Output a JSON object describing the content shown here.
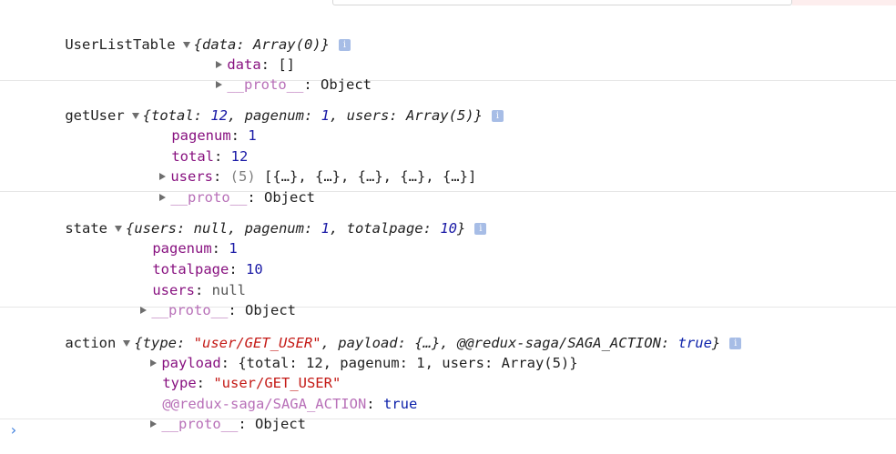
{
  "info_glyph": "i",
  "entries": [
    {
      "label": "UserListTable",
      "summary": {
        "pre": "{data: ",
        "val": "Array(0)",
        "post": "}"
      },
      "rows": [
        {
          "key": "data",
          "sep": ": ",
          "value": "[]"
        },
        {
          "key": "__proto__",
          "sep": ": ",
          "value": "Object"
        }
      ]
    },
    {
      "label": "getUser",
      "summary": {
        "p1": "{total: ",
        "v1": "12",
        "p2": ", pagenum: ",
        "v2": "1",
        "p3": ", users: Array(5)}"
      },
      "rows": [
        {
          "key": "pagenum",
          "sep": ": ",
          "value": "1"
        },
        {
          "key": "total",
          "sep": ": ",
          "value": "12"
        },
        {
          "key": "users",
          "sep": ": ",
          "count": "(5)",
          "value": " [{…}, {…}, {…}, {…}, {…}]"
        },
        {
          "key": "__proto__",
          "sep": ": ",
          "value": "Object"
        }
      ]
    },
    {
      "label": "state",
      "summary": {
        "p1": "{users: null, pagenum: ",
        "v1": "1",
        "p2": ", totalpage: ",
        "v2": "10",
        "p3": "}"
      },
      "rows": [
        {
          "key": "pagenum",
          "sep": ": ",
          "value": "1"
        },
        {
          "key": "totalpage",
          "sep": ": ",
          "value": "10"
        },
        {
          "key": "users",
          "sep": ": ",
          "value": "null"
        },
        {
          "key": "__proto__",
          "sep": ": ",
          "value": "Object"
        }
      ]
    },
    {
      "label": "action",
      "summary": {
        "p1": "{type: ",
        "v1": "\"user/GET_USER\"",
        "p2": ", payload: {…}, @@redux-saga/SAGA_ACTION: ",
        "v2": "true",
        "p3": "}"
      },
      "rows": [
        {
          "key": "payload",
          "sep": ": ",
          "value": "{total: 12, pagenum: 1, users: Array(5)}"
        },
        {
          "key": "type",
          "sep": ": ",
          "value": "\"user/GET_USER\""
        },
        {
          "key": "@@redux-saga/SAGA_ACTION",
          "sep": ": ",
          "value": "true"
        },
        {
          "key": "__proto__",
          "sep": ": ",
          "value": "Object"
        }
      ]
    }
  ],
  "prompt": "›",
  "colors": {
    "key": "#881280",
    "number": "#1a1aa6",
    "string": "#c41a16",
    "keyword": "#0d22aa",
    "prompt": "#3b7ddd"
  }
}
